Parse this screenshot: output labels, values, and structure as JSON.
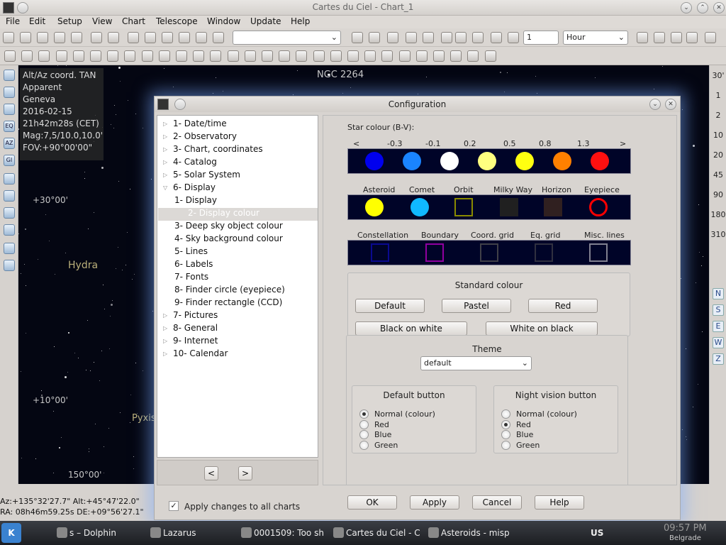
{
  "window": {
    "title": "Cartes du Ciel - Chart_1"
  },
  "menu": [
    "File",
    "Edit",
    "Setup",
    "View",
    "Chart",
    "Telescope",
    "Window",
    "Update",
    "Help"
  ],
  "toolbar": {
    "step_value": "1",
    "unit": "Hour"
  },
  "info": [
    "Alt/Az coord. TAN",
    "Apparent",
    "Geneva",
    "2016-02-15",
    "21h42m28s (CET)",
    "Mag:7,5/10.0,10.0'",
    "FOV:+90°00'00\""
  ],
  "sky_labels": {
    "ngc": "NGC 2264",
    "hydra": "Hydra",
    "pyxis": "Pyxis",
    "deg30": "+30°00'",
    "deg10": "+10°00'",
    "deg150": "150°00'"
  },
  "fov_list": [
    "30'",
    "1",
    "2",
    "10",
    "20",
    "45",
    "90",
    "180",
    "310"
  ],
  "compass": [
    "N",
    "S",
    "E",
    "W",
    "Z"
  ],
  "status": {
    "line1": "Az:+135°32'27.7\" Alt:+45°47'22.0\"",
    "line2": "RA: 08h46m59.25s DE:+09°56'27.1\""
  },
  "dialog": {
    "title": "Configuration",
    "tree": [
      {
        "label": "1- Date/time",
        "level": 0
      },
      {
        "label": "2- Observatory",
        "level": 0
      },
      {
        "label": "3- Chart, coordinates",
        "level": 0
      },
      {
        "label": "4- Catalog",
        "level": 0
      },
      {
        "label": "5- Solar System",
        "level": 0
      },
      {
        "label": "6- Display",
        "level": 0
      },
      {
        "label": "1- Display",
        "level": 1
      },
      {
        "label": "2- Display colour",
        "level": 1
      },
      {
        "label": "3- Deep sky object colour",
        "level": 1
      },
      {
        "label": "4- Sky background colour",
        "level": 1
      },
      {
        "label": "5- Lines",
        "level": 1
      },
      {
        "label": "6- Labels",
        "level": 1
      },
      {
        "label": "7- Fonts",
        "level": 1
      },
      {
        "label": "8- Finder circle (eyepiece)",
        "level": 1
      },
      {
        "label": "9- Finder rectangle (CCD)",
        "level": 1
      },
      {
        "label": "7- Pictures",
        "level": 0
      },
      {
        "label": "8- General",
        "level": 0
      },
      {
        "label": "9- Internet",
        "level": 0
      },
      {
        "label": "10- Calendar",
        "level": 0
      }
    ],
    "selected_item": "2- Display colour",
    "nav": {
      "prev": "<",
      "next": ">"
    },
    "star_colour": {
      "title": "Star colour (B-V):",
      "ticks": [
        "<",
        "-0.3",
        "-0.1",
        "0.2",
        "0.5",
        "0.8",
        "1.3",
        ">"
      ],
      "colors": [
        "#0000ee",
        "#1a84ff",
        "#ffffff",
        "#ffff80",
        "#ffff10",
        "#ff8000",
        "#ff1010"
      ]
    },
    "objects": {
      "labels": [
        "Asteroid",
        "Comet",
        "Orbit",
        "Milky Way",
        "Horizon",
        "Eyepiece"
      ],
      "colors": [
        "#ffff00",
        "#10b8ff",
        "#8a8a00",
        "#202020",
        "#302020",
        "#ff0000"
      ]
    },
    "lines": {
      "labels": [
        "Constellation",
        "Boundary",
        "Coord. grid",
        "Eq. grid",
        "Misc. lines"
      ],
      "colors": [
        "#0a0a90",
        "#9000a0",
        "#404048",
        "#303040",
        "#808090"
      ]
    },
    "standard": {
      "title": "Standard  colour",
      "buttons": [
        "Default",
        "Pastel",
        "Red",
        "Black on white",
        "White on black"
      ]
    },
    "theme": {
      "title": "Theme",
      "value": "default"
    },
    "default_button": {
      "title": "Default button",
      "options": [
        "Normal (colour)",
        "Red",
        "Blue",
        "Green"
      ],
      "selected": 0
    },
    "night_button": {
      "title": "Night vision button",
      "options": [
        "Normal (colour)",
        "Red",
        "Blue",
        "Green"
      ],
      "selected": 1
    },
    "footer": {
      "apply_all": "Apply changes to all charts",
      "ok": "OK",
      "apply": "Apply",
      "cancel": "Cancel",
      "help": "Help"
    }
  },
  "taskbar": {
    "items": [
      "s – Dolphin",
      "Lazarus",
      "0001509: Too sh",
      "Cartes du Ciel - C",
      "Asteroids - misp"
    ],
    "kb": "US",
    "time": "09:57 PM",
    "city": "Belgrade"
  }
}
